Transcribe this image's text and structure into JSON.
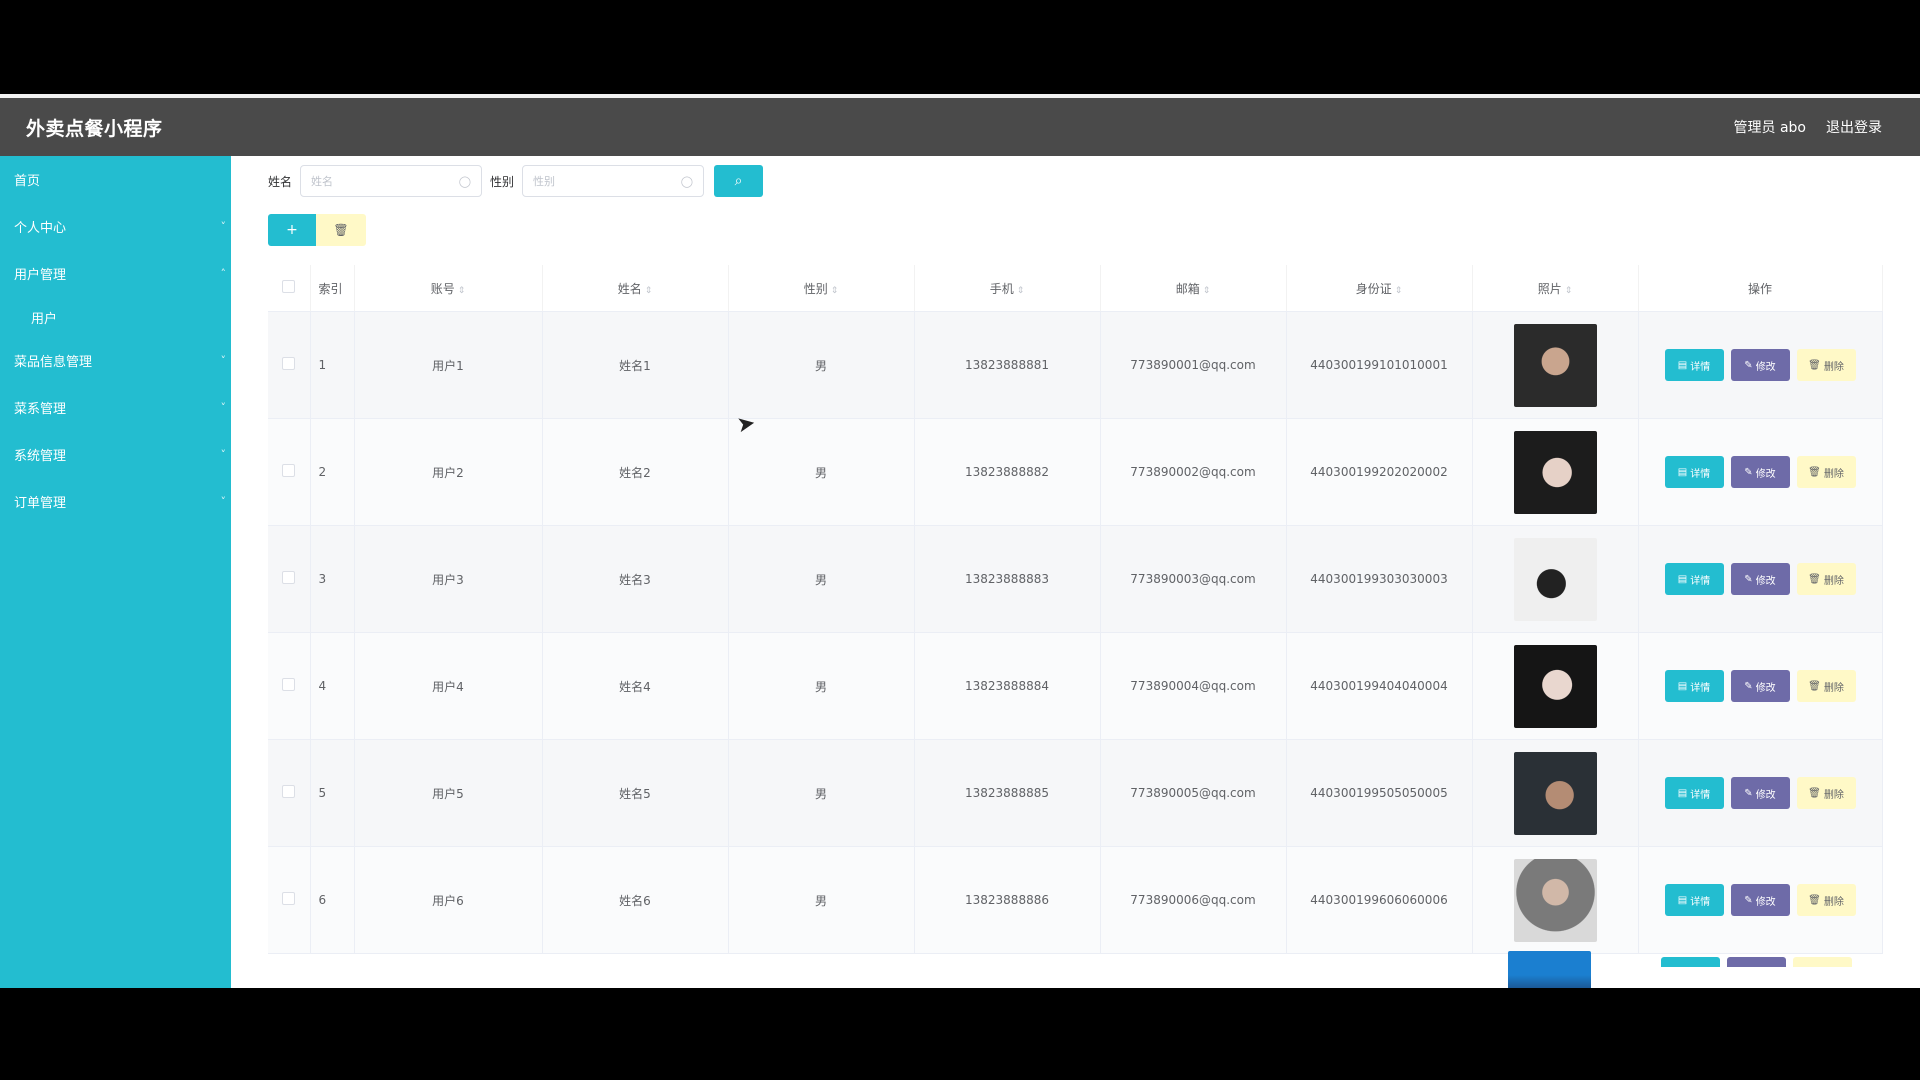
{
  "header": {
    "app_title": "外卖点餐小程序",
    "admin_label": "管理员 abo",
    "logout_label": "退出登录"
  },
  "sidebar": {
    "items": [
      {
        "label": "首页",
        "chevron": ""
      },
      {
        "label": "个人中心",
        "chevron": "˅"
      },
      {
        "label": "用户管理",
        "chevron": "˄"
      },
      {
        "label": "用户",
        "chevron": ""
      },
      {
        "label": "菜品信息管理",
        "chevron": "˅"
      },
      {
        "label": "菜系管理",
        "chevron": "˅"
      },
      {
        "label": "系统管理",
        "chevron": "˅"
      },
      {
        "label": "订单管理",
        "chevron": "˅"
      }
    ]
  },
  "search": {
    "name_label": "姓名",
    "name_placeholder": "姓名",
    "gender_label": "性别",
    "gender_placeholder": "性别",
    "search_icon": "search-icon"
  },
  "toolbar": {
    "add_label": "+",
    "delete_icon": "trash-icon"
  },
  "table": {
    "headers": [
      "索引",
      "账号",
      "姓名",
      "性别",
      "手机",
      "邮箱",
      "身份证",
      "照片",
      "操作"
    ],
    "rows": [
      {
        "index": "1",
        "account": "用户1",
        "name": "姓名1",
        "gender": "男",
        "phone": "13823888881",
        "email": "773890001@qq.com",
        "id_card": "440300199101010001"
      },
      {
        "index": "2",
        "account": "用户2",
        "name": "姓名2",
        "gender": "男",
        "phone": "13823888882",
        "email": "773890002@qq.com",
        "id_card": "440300199202020002"
      },
      {
        "index": "3",
        "account": "用户3",
        "name": "姓名3",
        "gender": "男",
        "phone": "13823888883",
        "email": "773890003@qq.com",
        "id_card": "440300199303030003"
      },
      {
        "index": "4",
        "account": "用户4",
        "name": "姓名4",
        "gender": "男",
        "phone": "13823888884",
        "email": "773890004@qq.com",
        "id_card": "440300199404040004"
      },
      {
        "index": "5",
        "account": "用户5",
        "name": "姓名5",
        "gender": "男",
        "phone": "13823888885",
        "email": "773890005@qq.com",
        "id_card": "440300199505050005"
      },
      {
        "index": "6",
        "account": "用户6",
        "name": "姓名6",
        "gender": "男",
        "phone": "13823888886",
        "email": "773890006@qq.com",
        "id_card": "440300199606060006"
      }
    ],
    "op_labels": {
      "detail": "详情",
      "edit": "修改",
      "delete": "删除"
    }
  },
  "colors": {
    "accent": "#23bdd0",
    "topbar": "#4a4a4a",
    "edit_button": "#6e6ba8",
    "delete_button": "#fff9c7"
  }
}
